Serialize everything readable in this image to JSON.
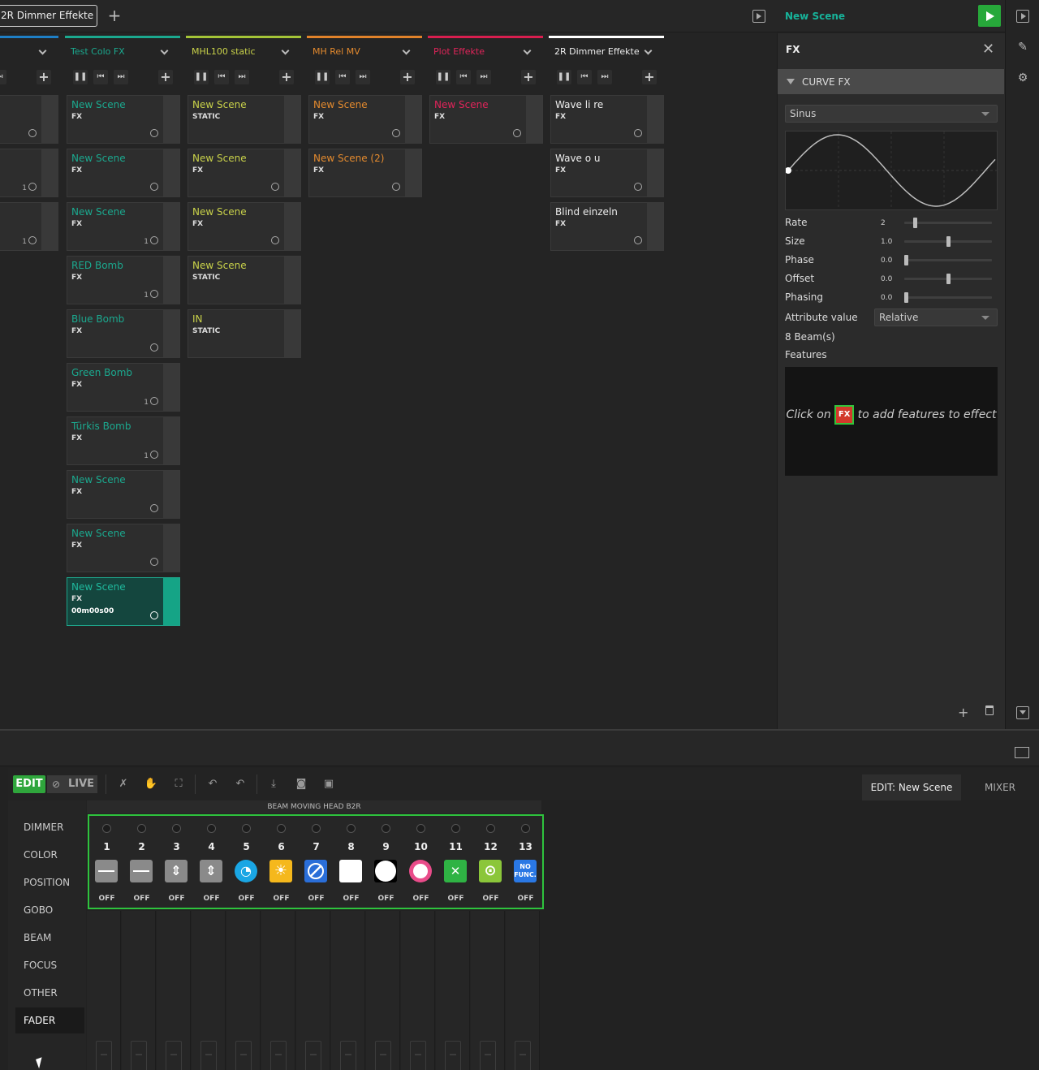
{
  "header": {
    "active_tab": "2R Dimmer Effekte",
    "add_tab": "+"
  },
  "columns": [
    {
      "title": "",
      "color": "#1e7fc6",
      "title_color": "#aaaaaa",
      "scenes": [
        {
          "name": "",
          "type": "",
          "num": ""
        },
        {
          "name": "",
          "type": "",
          "num": "1"
        },
        {
          "name": "",
          "type": "",
          "num": "1"
        }
      ]
    },
    {
      "title": "Test Colo FX",
      "color": "#1ba98f",
      "title_color": "#1ba98f",
      "scenes": [
        {
          "name": "New Scene",
          "type": "FX",
          "num": ""
        },
        {
          "name": "New Scene",
          "type": "FX",
          "num": ""
        },
        {
          "name": "New Scene",
          "type": "FX",
          "num": "1"
        },
        {
          "name": "RED Bomb",
          "type": "FX",
          "num": "1"
        },
        {
          "name": "Blue Bomb",
          "type": "FX",
          "num": ""
        },
        {
          "name": "Green Bomb",
          "type": "FX",
          "num": "1"
        },
        {
          "name": "Türkis Bomb",
          "type": "FX",
          "num": "1"
        },
        {
          "name": "New Scene",
          "type": "FX",
          "num": ""
        },
        {
          "name": "New Scene",
          "type": "FX",
          "num": ""
        },
        {
          "name": "New Scene",
          "type": "FX",
          "num": "",
          "time": "00m00s00",
          "active": true
        }
      ]
    },
    {
      "title": "MHL100 static",
      "color": "#a4c437",
      "title_color": "#c9d24a",
      "scenes": [
        {
          "name": "New Scene",
          "type": "STATIC",
          "num": ""
        },
        {
          "name": "New Scene",
          "type": "FX",
          "num": ""
        },
        {
          "name": "New Scene",
          "type": "FX",
          "num": ""
        },
        {
          "name": "New Scene",
          "type": "STATIC",
          "num": ""
        },
        {
          "name": "IN",
          "type": "STATIC",
          "num": ""
        }
      ]
    },
    {
      "title": "MH Rel MV",
      "color": "#e0822a",
      "title_color": "#e38a2e",
      "scenes": [
        {
          "name": "New Scene",
          "type": "FX",
          "num": ""
        },
        {
          "name": "New Scene (2)",
          "type": "FX",
          "num": ""
        }
      ]
    },
    {
      "title": "Plot Effekte",
      "color": "#d81e4f",
      "title_color": "#e0245a",
      "scenes": [
        {
          "name": "New Scene",
          "type": "FX",
          "num": ""
        }
      ]
    },
    {
      "title": "2R Dimmer Effekte",
      "color": "#ffffff",
      "title_color": "#eeeeee",
      "scenes": [
        {
          "name": "Wave li re",
          "type": "FX",
          "num": ""
        },
        {
          "name": "Wave o u",
          "type": "FX",
          "num": ""
        },
        {
          "name": "Blind einzeln",
          "type": "FX",
          "num": ""
        }
      ]
    }
  ],
  "right_panel": {
    "scene_title": "New Scene",
    "fx_label": "FX",
    "section_title": "CURVE FX",
    "curve_select": "Sinus",
    "params": [
      {
        "label": "Rate",
        "value": "2",
        "level": 0.11
      },
      {
        "label": "Size",
        "value": "1.0",
        "level": 0.5
      },
      {
        "label": "Phase",
        "value": "0.0",
        "level": 0.0
      },
      {
        "label": "Offset",
        "value": "0.0",
        "level": 0.5
      },
      {
        "label": "Phasing",
        "value": "0.0",
        "level": 0.0
      }
    ],
    "attribute_label": "Attribute value",
    "attribute_select": "Relative",
    "beams": "8 Beam(s)",
    "features_label": "Features",
    "features_hint_a": "Click on",
    "features_badge": "FX",
    "features_hint_b": "to add features to effect"
  },
  "bottom": {
    "edit_label": "EDIT",
    "live_label": "LIVE",
    "edit_tab": "EDIT: New Scene",
    "mixer_tab": "MIXER",
    "fixture_title": "BEAM MOVING HEAD B2R",
    "categories": [
      "DIMMER",
      "COLOR",
      "POSITION",
      "GOBO",
      "BEAM",
      "FOCUS",
      "OTHER",
      "FADER"
    ],
    "selected_category": "FADER",
    "channels": [
      {
        "num": "1",
        "state": "OFF",
        "icon": "slider-h-icon",
        "bg": "#8a8a8a"
      },
      {
        "num": "2",
        "state": "OFF",
        "icon": "slider-h-icon",
        "bg": "#8a8a8a"
      },
      {
        "num": "3",
        "state": "OFF",
        "icon": "slider-v-icon",
        "bg": "#8a8a8a"
      },
      {
        "num": "4",
        "state": "OFF",
        "icon": "slider-v-icon",
        "bg": "#8a8a8a"
      },
      {
        "num": "5",
        "state": "OFF",
        "icon": "speed-gauge-icon",
        "bg": "#1aa6e4"
      },
      {
        "num": "6",
        "state": "OFF",
        "icon": "sun-icon",
        "bg": "#f5b81c"
      },
      {
        "num": "7",
        "state": "OFF",
        "icon": "no-shutter-icon",
        "bg": "#2a6ed8"
      },
      {
        "num": "8",
        "state": "OFF",
        "icon": "white-square-icon",
        "bg": "#ffffff"
      },
      {
        "num": "9",
        "state": "OFF",
        "icon": "white-circle-icon",
        "bg": "#000000"
      },
      {
        "num": "10",
        "state": "OFF",
        "icon": "pink-circle-icon",
        "bg": "#e94c8a"
      },
      {
        "num": "11",
        "state": "OFF",
        "icon": "reset-x-icon",
        "bg": "#2fb344"
      },
      {
        "num": "12",
        "state": "OFF",
        "icon": "focus-target-icon",
        "bg": "#8bc63a"
      },
      {
        "num": "13",
        "state": "OFF",
        "icon": "no-function-icon",
        "bg": "#2a78e4",
        "text": "NO FUNC."
      }
    ]
  }
}
